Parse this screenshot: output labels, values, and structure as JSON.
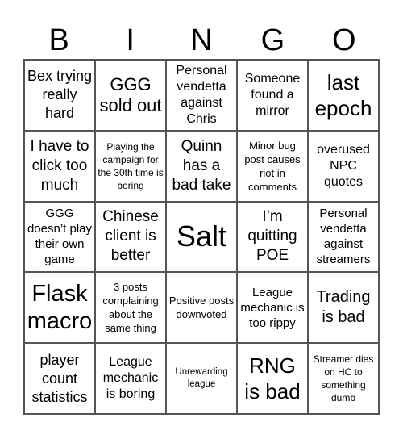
{
  "header": [
    "B",
    "I",
    "N",
    "G",
    "O"
  ],
  "cells": [
    "Bex trying really hard",
    "GGG sold out",
    "Personal vendetta against Chris",
    "Someone found a mirror",
    "last epoch",
    "I have to click too much",
    "Playing the campaign for the 30th time is boring",
    "Quinn has a bad take",
    "Minor bug post causes riot in comments",
    "overused NPC quotes",
    "GGG doesn’t play their own game",
    "Chinese client is better",
    "Salt",
    "I’m quitting POE",
    "Personal vendetta against streamers",
    "Flask macro",
    "3 posts complaining about the same thing",
    "Positive posts downvoted",
    "League mechanic is too rippy",
    "Trading is bad",
    "player count statistics",
    "League mechanic is boring",
    "Unrewarding league",
    "RNG is bad",
    "Streamer dies on HC to something dumb"
  ]
}
